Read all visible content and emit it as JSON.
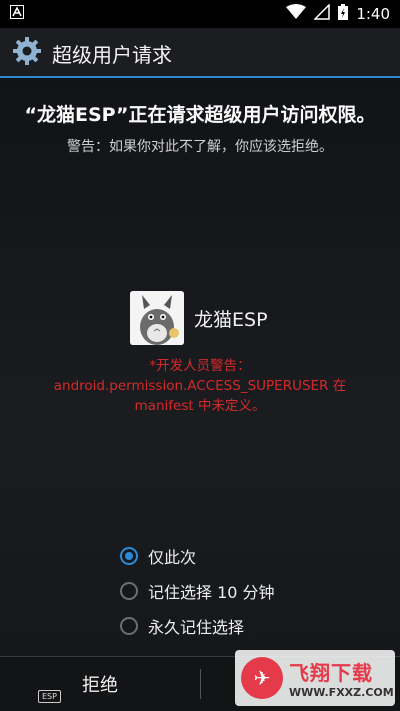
{
  "status_bar": {
    "time": "1:40",
    "icons": [
      "notification-a-icon",
      "wifi-icon",
      "signal-icon",
      "battery-charging-icon"
    ]
  },
  "action_bar": {
    "title": "超级用户请求",
    "icon": "gear-icon"
  },
  "dialog": {
    "heading": "“龙猫ESP”正在请求超级用户访问权限。",
    "warning": "警告：如果你对此不了解，你应该选拒绝。",
    "app_name": "龙猫ESP",
    "developer_warning": [
      "*开发人员警告：",
      "android.permission.ACCESS_SUPERUSER 在",
      "manifest 中未定义。"
    ],
    "accent_color": "#2d8ad6",
    "warning_color": "#d42a2a"
  },
  "options": {
    "items": [
      {
        "label": "仅此次",
        "checked": true
      },
      {
        "label": "记住选择 10 分钟",
        "checked": false
      },
      {
        "label": "永久记住选择",
        "checked": false
      }
    ]
  },
  "buttons": {
    "deny": "拒绝",
    "allow": "",
    "esp_badge": "ESP"
  },
  "watermark": {
    "main": "飞翔下载",
    "sub": "WWW.FXXZ.COM"
  }
}
